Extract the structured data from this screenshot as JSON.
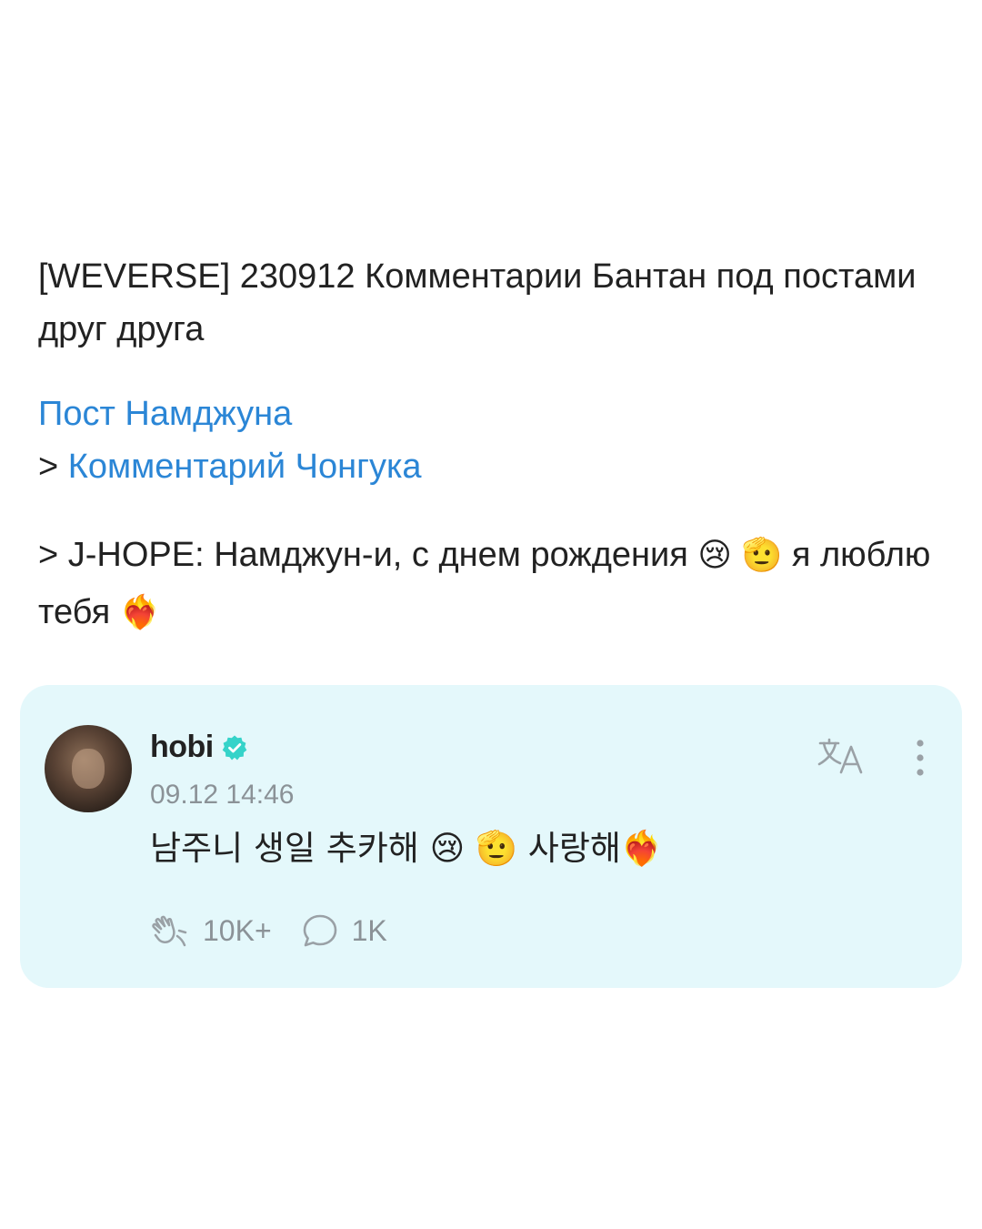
{
  "post": {
    "title": "[WEVERSE] 230912 Комментарии Бантан под постами друг друга",
    "link_post": "Пост Намджуна",
    "link_prefix": "> ",
    "link_comment": "Комментарий Чонгука",
    "quote_prefix": "> J-HOPE: Намджун-и, с днем рождения ",
    "quote_emoji_1": "😢",
    "quote_emoji_2": "🫡",
    "quote_mid": " я люблю тебя ",
    "quote_emoji_3": "❤️‍🔥"
  },
  "comment": {
    "username": "hobi",
    "timestamp": "09.12 14:46",
    "text_1": "남주니 생일 추카해 ",
    "emoji_1": "😢",
    "emoji_2": "🫡",
    "text_2": " 사랑해",
    "emoji_3": "❤️‍🔥",
    "likes": "10K+",
    "replies": "1K",
    "icons": {
      "verified": "verified-badge-icon",
      "translate": "translate-icon",
      "more": "more-vertical-icon",
      "like": "cheer-hand-icon",
      "reply": "comment-bubble-icon"
    },
    "background": "#e4f8fb",
    "accent": "#2b86d6"
  }
}
